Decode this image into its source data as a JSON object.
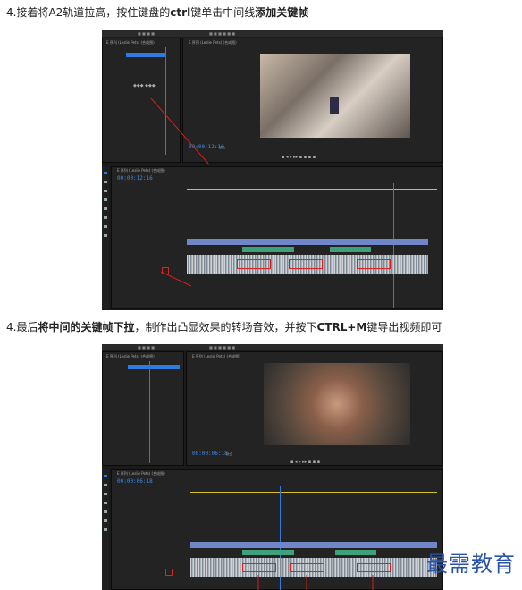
{
  "steps": [
    {
      "prefix": "4.接着将A2轨道拉高，按住键盘的",
      "bold1": "ctrl",
      "middle": "键单击中间线",
      "bold2": "添加关键帧",
      "suffix": ""
    },
    {
      "prefix": "4.最后",
      "bold1": "将中间的关键帧下拉",
      "middle": "，制作出凸显效果的转场音效，并按下",
      "bold2": "CTRL+M",
      "suffix": "键导出视频即可"
    }
  ],
  "shot1": {
    "timecode_program": "00:00:12:16",
    "timecode_sequence": "00:00:12:16",
    "sequence_tab": "E 序列 (Leslie Pets) (合成图)",
    "source_tab": "E 序列 (Leslie Pets) (合成图)",
    "fit": "适合"
  },
  "shot2": {
    "timecode_program": "00:00:06:18",
    "timecode_sequence": "00:00:06:18",
    "sequence_tab": "E 序列 (Leslie Pets) (合成图)",
    "source_tab": "E 序列 (Leslie Pets) (合成图)",
    "fit": "适合"
  },
  "watermark": "最需教育",
  "colors": {
    "accent_blue": "#3a8ee6",
    "keyframe_red": "#e02020",
    "clip_video": "#6f86c8",
    "clip_audio": "#3fa17b"
  }
}
